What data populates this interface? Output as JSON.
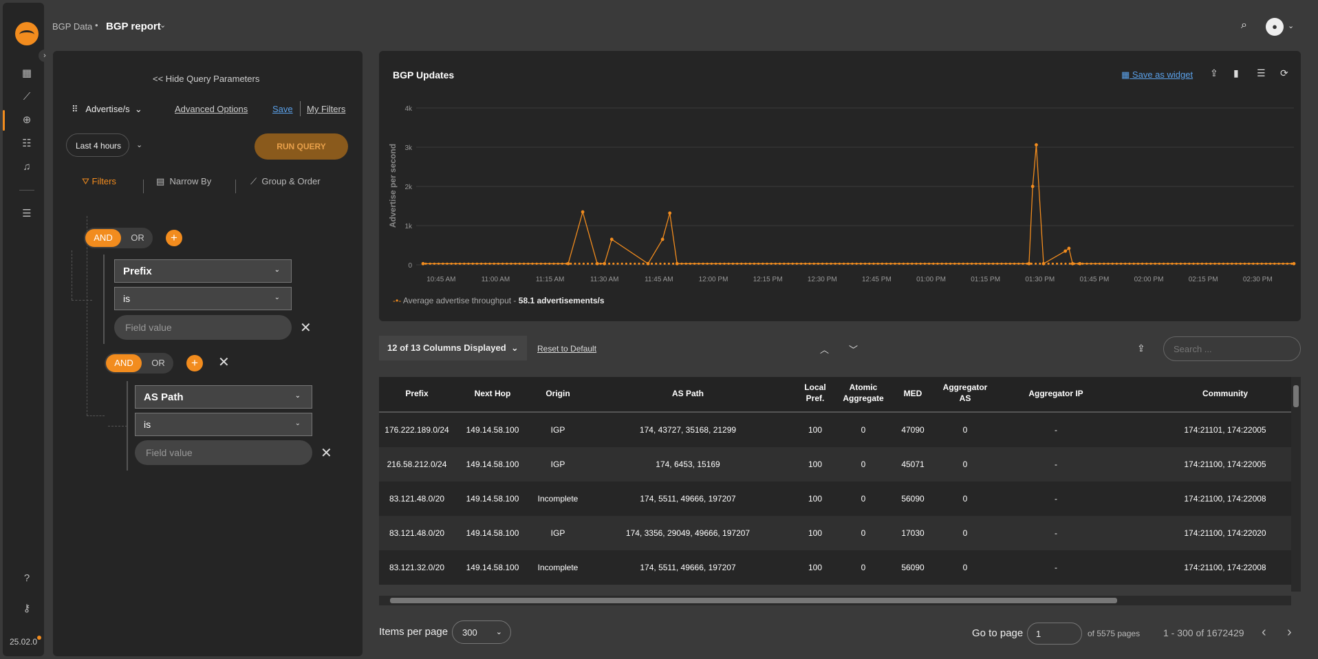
{
  "rail": {
    "version": "25.02.0"
  },
  "topbar": {
    "crumb_root": "BGP Data",
    "crumb_sep": "•",
    "page_title": "BGP report"
  },
  "query": {
    "hide_label": "Hide Query Parameters",
    "metric": "Advertise/s",
    "advanced": "Advanced Options",
    "save": "Save",
    "my_filters": "My Filters",
    "time_range": "Last 4 hours",
    "run": "RUN QUERY",
    "tabs": {
      "filters": "Filters",
      "narrow": "Narrow By",
      "group": "Group & Order"
    },
    "groups": [
      {
        "and": "AND",
        "or": "OR",
        "field": "Prefix",
        "op": "is",
        "placeholder": "Field value"
      },
      {
        "and": "AND",
        "or": "OR",
        "field": "AS Path",
        "op": "is",
        "placeholder": "Field value"
      }
    ]
  },
  "chart_card": {
    "title": "BGP Updates",
    "save_widget": "Save as widget",
    "legend_label": "Average advertise throughput -",
    "legend_value": "58.1 advertisements/s"
  },
  "chart_data": {
    "type": "line",
    "title": "BGP Updates",
    "ylabel": "Advertise per second",
    "ylim": [
      0,
      4000
    ],
    "yticks": [
      "0",
      "1k",
      "2k",
      "3k",
      "4k"
    ],
    "xticks": [
      "10:45 AM",
      "11:00 AM",
      "11:15 AM",
      "11:30 AM",
      "11:45 AM",
      "12:00 PM",
      "12:15 PM",
      "12:30 PM",
      "12:45 PM",
      "01:00 PM",
      "01:15 PM",
      "01:30 PM",
      "01:45 PM",
      "02:00 PM",
      "02:15 PM",
      "02:30 PM"
    ],
    "series": [
      {
        "name": "Average advertise throughput",
        "color": "#f28c1e",
        "x": [
          "10:40 AM",
          "11:20 AM",
          "11:24 AM",
          "11:28 AM",
          "11:30 AM",
          "11:32 AM",
          "11:42 AM",
          "11:46 AM",
          "11:48 AM",
          "11:50 AM",
          "01:27 PM",
          "01:28 PM",
          "01:29 PM",
          "01:31 PM",
          "01:37 PM",
          "01:38 PM",
          "01:39 PM",
          "01:41 PM",
          "02:40 PM"
        ],
        "values": [
          30,
          30,
          1350,
          30,
          30,
          650,
          30,
          650,
          1320,
          30,
          30,
          2000,
          3060,
          30,
          350,
          420,
          30,
          30,
          30
        ]
      }
    ]
  },
  "table_controls": {
    "columns_displayed": "12 of 13 Columns Displayed",
    "reset": "Reset to Default",
    "search_placeholder": "Search ..."
  },
  "table": {
    "headers": [
      "Prefix",
      "Next Hop",
      "Origin",
      "AS Path",
      "Local Pref.",
      "Atomic Aggregate",
      "MED",
      "Aggregator AS",
      "Aggregator IP",
      "Community"
    ],
    "rows": [
      [
        "176.222.189.0/24",
        "149.14.58.100",
        "IGP",
        "174, 43727, 35168, 21299",
        "100",
        "0",
        "47090",
        "0",
        "-",
        "174:21101, 174:22005"
      ],
      [
        "216.58.212.0/24",
        "149.14.58.100",
        "IGP",
        "174, 6453, 15169",
        "100",
        "0",
        "45071",
        "0",
        "-",
        "174:21100, 174:22005"
      ],
      [
        "83.121.48.0/20",
        "149.14.58.100",
        "Incomplete",
        "174, 5511, 49666, 197207",
        "100",
        "0",
        "56090",
        "0",
        "-",
        "174:21100, 174:22008"
      ],
      [
        "83.121.48.0/20",
        "149.14.58.100",
        "IGP",
        "174, 3356, 29049, 49666, 197207",
        "100",
        "0",
        "17030",
        "0",
        "-",
        "174:21100, 174:22020"
      ],
      [
        "83.121.32.0/20",
        "149.14.58.100",
        "Incomplete",
        "174, 5511, 49666, 197207",
        "100",
        "0",
        "56090",
        "0",
        "-",
        "174:21100, 174:22008"
      ]
    ]
  },
  "pagination": {
    "items_per_page_label": "Items per page",
    "items_per_page": "300",
    "goto_label": "Go to page",
    "goto_value": "1",
    "of_pages": "of 5575 pages",
    "range": "1 - 300 of 1672429"
  }
}
